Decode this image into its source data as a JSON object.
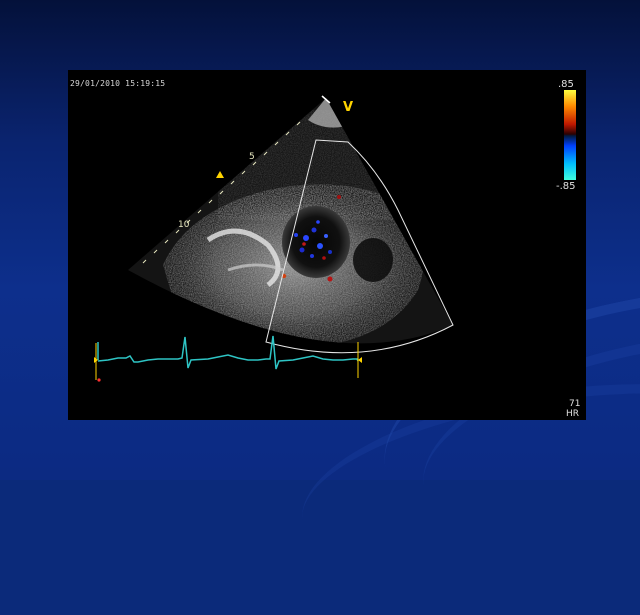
{
  "timestamp": "29/01/2010 15:19:15",
  "color_scale": {
    "top": ".85",
    "bottom": "-.85"
  },
  "depth_labels": {
    "d5": "5",
    "d10": "10"
  },
  "orientation_marker": "V",
  "heart_rate": {
    "value": "71",
    "label": "HR"
  },
  "colors": {
    "ecg_trace": "#2ec4c4",
    "marker_yellow": "#ffd400",
    "background_blue": "#0b2a7a"
  }
}
